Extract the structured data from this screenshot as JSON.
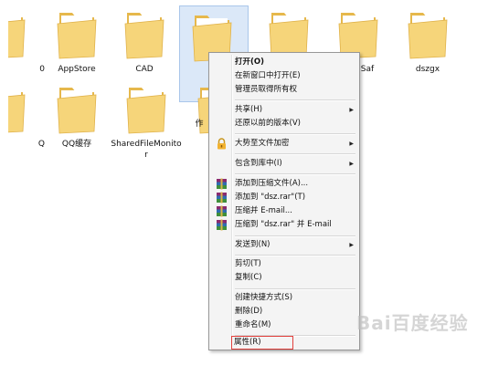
{
  "folders": [
    {
      "label": "0"
    },
    {
      "label": "AppStore"
    },
    {
      "label": "CAD"
    },
    {
      "label": ""
    },
    {
      "label": ""
    },
    {
      "label": "Saf"
    },
    {
      "label": "dszgx"
    },
    {
      "label": "Q"
    },
    {
      "label": "QQ缓存"
    },
    {
      "label": "SharedFileMonitor"
    },
    {
      "label": "作"
    }
  ],
  "context_menu": {
    "items": [
      {
        "label": "打开(O)"
      },
      {
        "label": "在新窗口中打开(E)"
      },
      {
        "label": "管理员取得所有权"
      },
      {
        "label": "共享(H)"
      },
      {
        "label": "还原以前的版本(V)"
      },
      {
        "label": "大势至文件加密"
      },
      {
        "label": "包含到库中(I)"
      },
      {
        "label": "添加到压缩文件(A)..."
      },
      {
        "label": "添加到 \"dsz.rar\"(T)"
      },
      {
        "label": "压缩并 E-mail..."
      },
      {
        "label": "压缩到 \"dsz.rar\" 并 E-mail"
      },
      {
        "label": "发送到(N)"
      },
      {
        "label": "剪切(T)"
      },
      {
        "label": "复制(C)"
      },
      {
        "label": "创建快捷方式(S)"
      },
      {
        "label": "删除(D)"
      },
      {
        "label": "重命名(M)"
      },
      {
        "label": "属性(R)"
      }
    ]
  },
  "watermark": "Bai百度经验",
  "colors": {
    "folder_body": "#f6d57a",
    "folder_back": "#e6b84c",
    "selection": "#dbe8f8",
    "highlight_border": "#e2403c"
  }
}
